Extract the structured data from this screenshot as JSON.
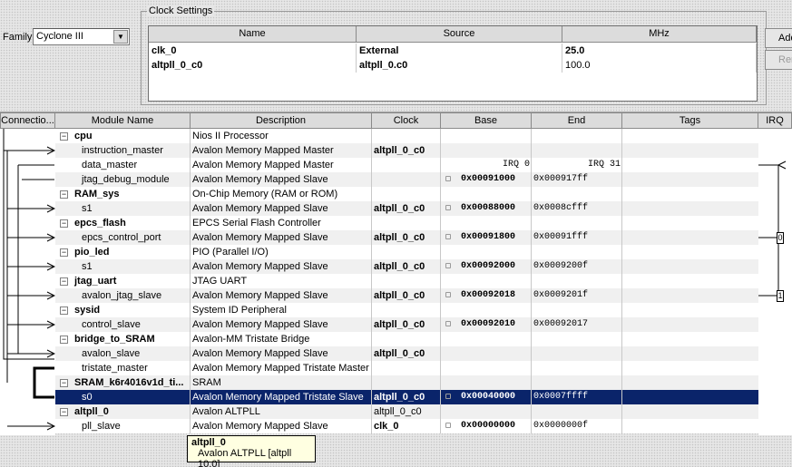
{
  "family": {
    "label": "Family:",
    "value": "Cyclone III"
  },
  "clock_settings": {
    "title": "Clock Settings",
    "headers": [
      "Name",
      "Source",
      "MHz"
    ],
    "rows": [
      {
        "name": "clk_0",
        "source": "External",
        "mhz": "25.0"
      },
      {
        "name": "altpll_0_c0",
        "source": "altpll_0.c0",
        "mhz": "100.0"
      }
    ],
    "add_label": "Add",
    "remove_label": "Remove"
  },
  "modules": {
    "headers": [
      "Connectio...",
      "Module Name",
      "Description",
      "Clock",
      "Base",
      "End",
      "Tags",
      "IRQ"
    ],
    "rows": [
      {
        "name": "cpu",
        "desc": "Nios II Processor",
        "clock": "",
        "base": "",
        "end": "",
        "component": true
      },
      {
        "name": "instruction_master",
        "desc": "Avalon Memory Mapped Master",
        "clock": "altpll_0_c0",
        "base": "",
        "end": ""
      },
      {
        "name": "data_master",
        "desc": "Avalon Memory Mapped Master",
        "clock": "",
        "base": "IRQ 0",
        "end": "IRQ 31"
      },
      {
        "name": "jtag_debug_module",
        "desc": "Avalon Memory Mapped Slave",
        "clock": "",
        "base": "0x00091000",
        "end": "0x000917ff"
      },
      {
        "name": "RAM_sys",
        "desc": "On-Chip Memory (RAM or ROM)",
        "clock": "",
        "base": "",
        "end": "",
        "component": true
      },
      {
        "name": "s1",
        "desc": "Avalon Memory Mapped Slave",
        "clock": "altpll_0_c0",
        "base": "0x00088000",
        "end": "0x0008cfff"
      },
      {
        "name": "epcs_flash",
        "desc": "EPCS Serial Flash Controller",
        "clock": "",
        "base": "",
        "end": "",
        "component": true
      },
      {
        "name": "epcs_control_port",
        "desc": "Avalon Memory Mapped Slave",
        "clock": "altpll_0_c0",
        "base": "0x00091800",
        "end": "0x00091fff"
      },
      {
        "name": "pio_led",
        "desc": "PIO (Parallel I/O)",
        "clock": "",
        "base": "",
        "end": "",
        "component": true
      },
      {
        "name": "s1",
        "desc": "Avalon Memory Mapped Slave",
        "clock": "altpll_0_c0",
        "base": "0x00092000",
        "end": "0x0009200f"
      },
      {
        "name": "jtag_uart",
        "desc": "JTAG UART",
        "clock": "",
        "base": "",
        "end": "",
        "component": true
      },
      {
        "name": "avalon_jtag_slave",
        "desc": "Avalon Memory Mapped Slave",
        "clock": "altpll_0_c0",
        "base": "0x00092018",
        "end": "0x0009201f"
      },
      {
        "name": "sysid",
        "desc": "System ID Peripheral",
        "clock": "",
        "base": "",
        "end": "",
        "component": true
      },
      {
        "name": "control_slave",
        "desc": "Avalon Memory Mapped Slave",
        "clock": "altpll_0_c0",
        "base": "0x00092010",
        "end": "0x00092017"
      },
      {
        "name": "bridge_to_SRAM",
        "desc": "Avalon-MM Tristate Bridge",
        "clock": "",
        "base": "",
        "end": "",
        "component": true
      },
      {
        "name": "avalon_slave",
        "desc": "Avalon Memory Mapped Slave",
        "clock": "altpll_0_c0",
        "base": "",
        "end": ""
      },
      {
        "name": "tristate_master",
        "desc": "Avalon Memory Mapped Tristate Master",
        "clock": "",
        "base": "",
        "end": ""
      },
      {
        "name": "SRAM_k6r4016v1d_ti...",
        "desc": "SRAM",
        "clock": "",
        "base": "",
        "end": "",
        "component": true
      },
      {
        "name": "s0",
        "desc": "Avalon Memory Mapped Tristate Slave",
        "clock": "altpll_0_c0",
        "base": "0x00040000",
        "end": "0x0007ffff",
        "selected": true
      },
      {
        "name": "altpll_0",
        "desc": "Avalon ALTPLL",
        "clock": "altpll_0_c0",
        "base": "",
        "end": "",
        "component": true
      },
      {
        "name": "pll_slave",
        "desc": "Avalon Memory Mapped Slave",
        "clock": "clk_0",
        "base": "0x00000000",
        "end": "0x0000000f"
      }
    ],
    "irq": [
      "0",
      "1"
    ]
  },
  "tooltip": {
    "title": "altpll_0",
    "body": "Avalon ALTPLL [altpll 10.0]"
  }
}
